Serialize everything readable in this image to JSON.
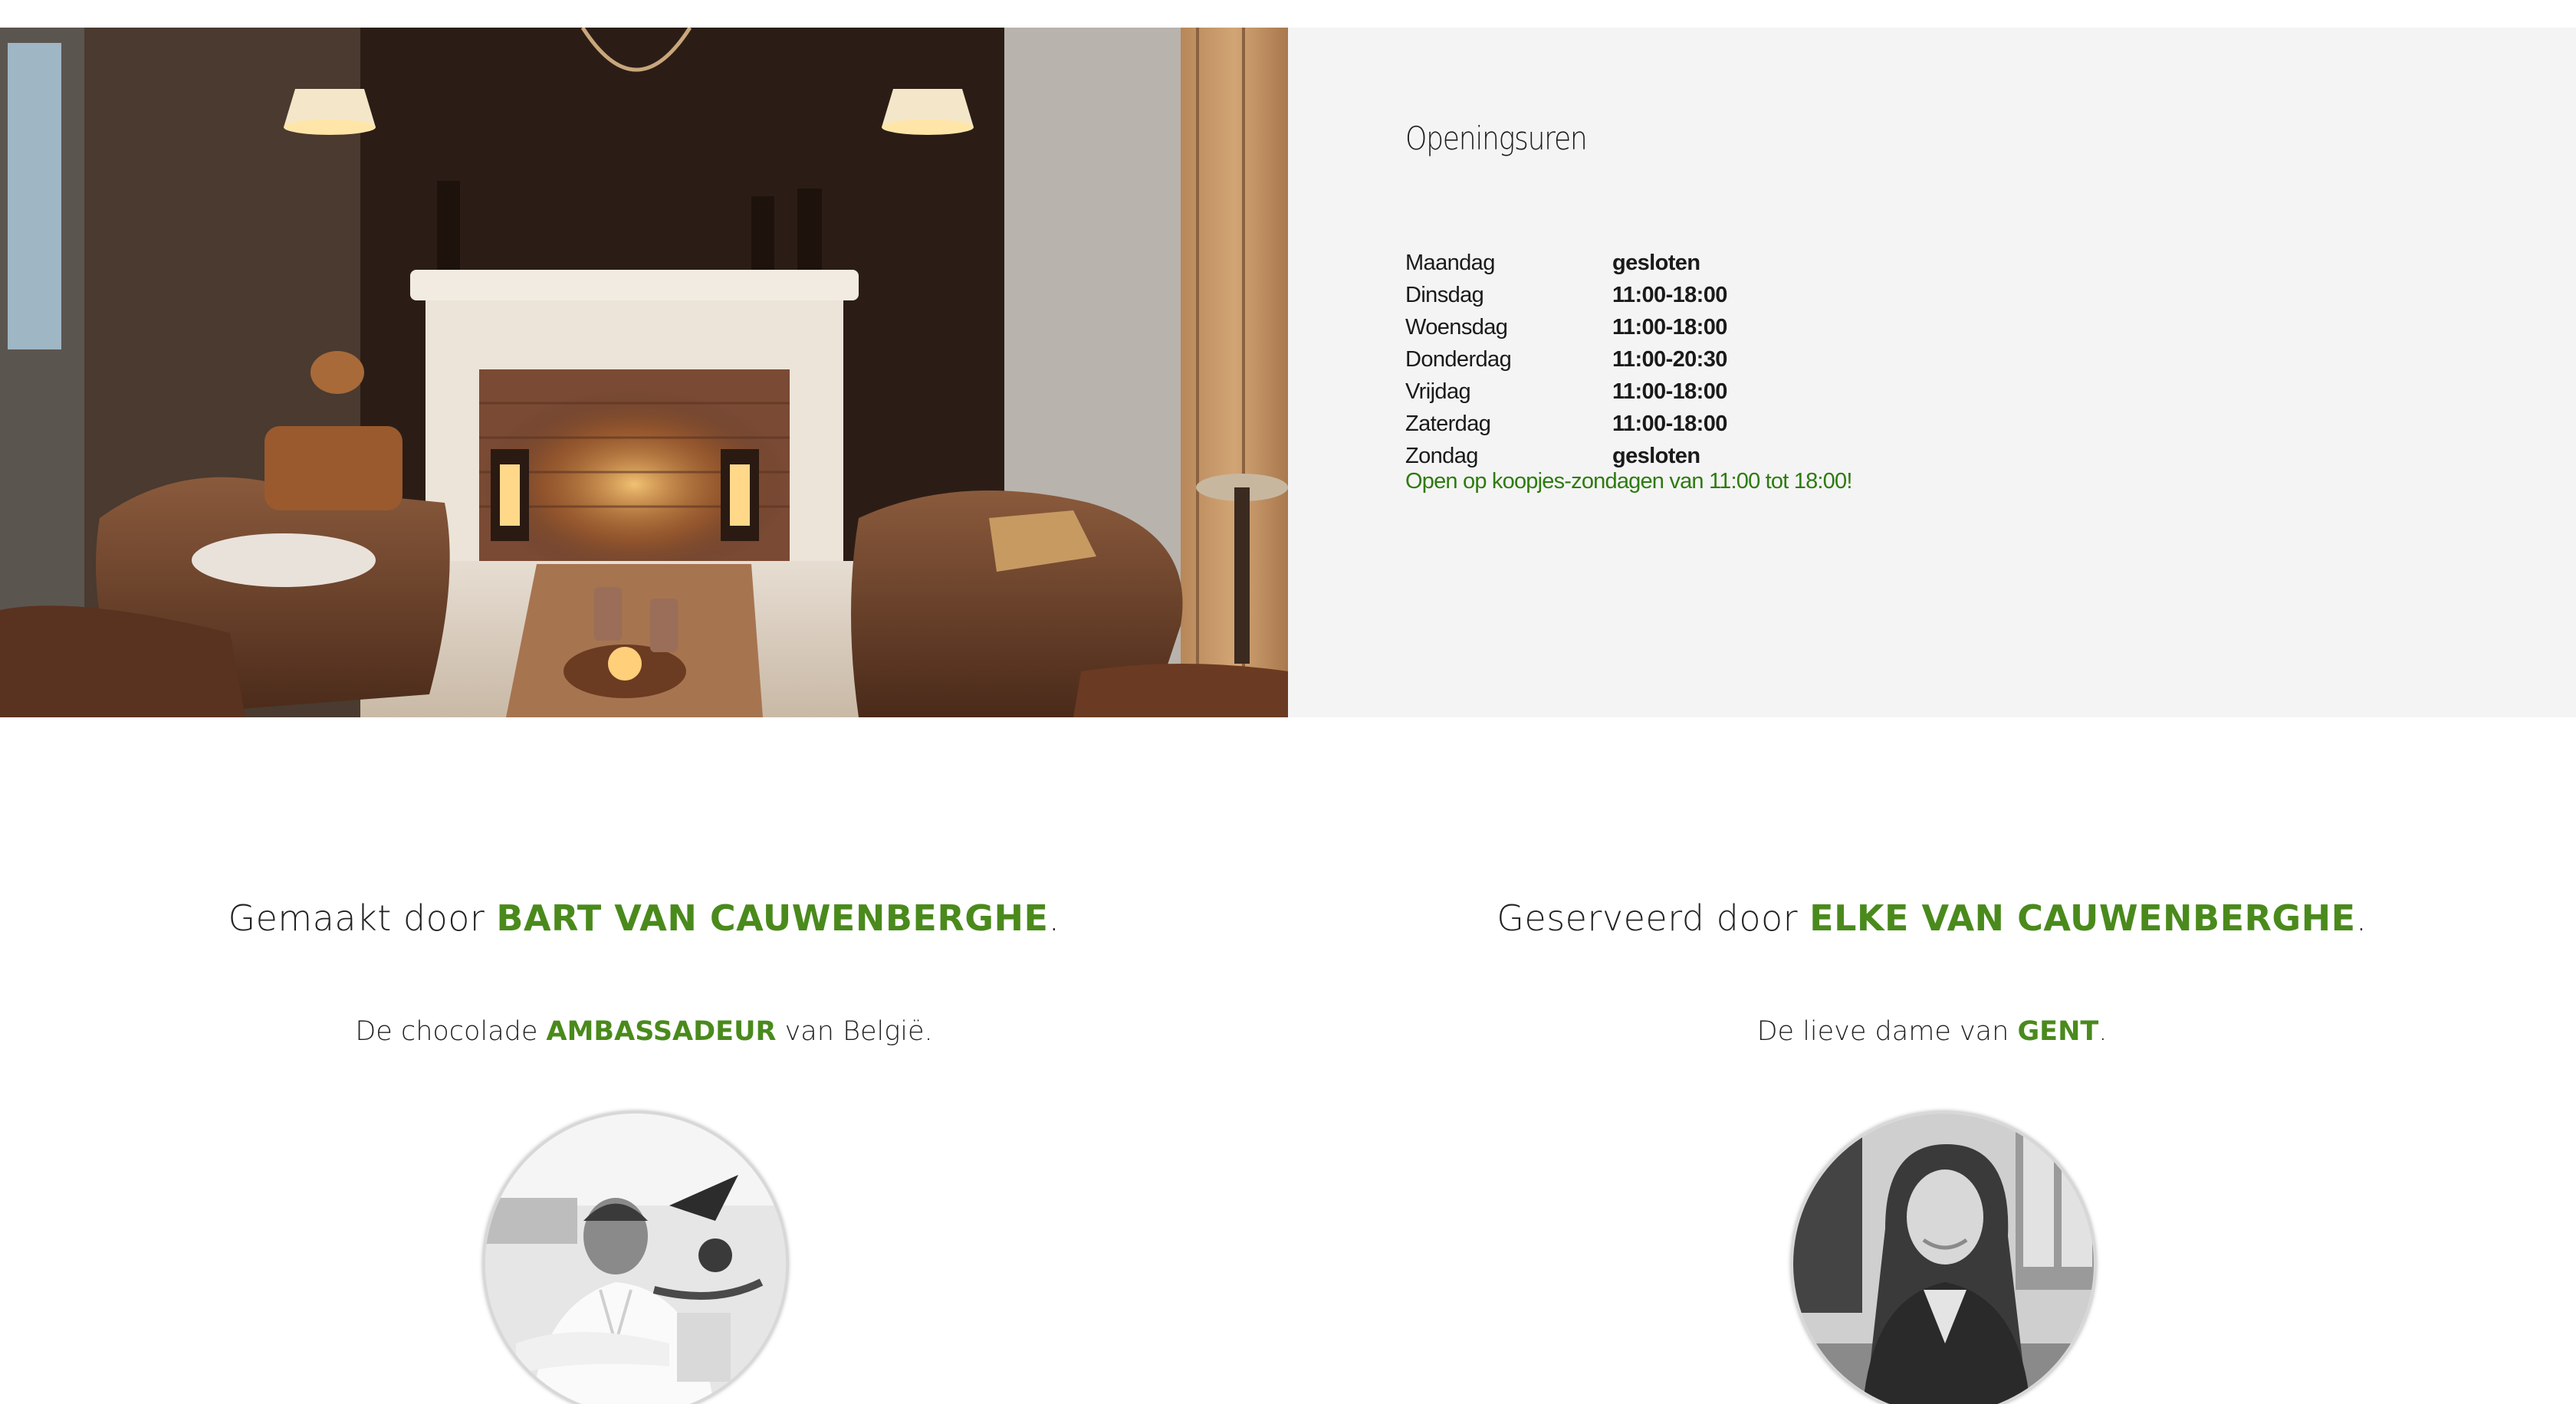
{
  "hours": {
    "title": "Openingsuren",
    "rows": [
      {
        "day": "Maandag",
        "time": "gesloten"
      },
      {
        "day": "Dinsdag",
        "time": "11:00-18:00"
      },
      {
        "day": "Woensdag",
        "time": "11:00-18:00"
      },
      {
        "day": "Donderdag",
        "time": "11:00-20:30"
      },
      {
        "day": "Vrijdag",
        "time": "11:00-18:00"
      },
      {
        "day": "Zaterdag",
        "time": "11:00-18:00"
      },
      {
        "day": "Zondag",
        "time": "gesloten"
      }
    ],
    "note": "Open op koopjes-zondagen van 11:00 tot 18:00!"
  },
  "people": [
    {
      "heading_prefix": "Gemaakt door ",
      "heading_name": "BART VAN CAUWENBERGHE",
      "heading_suffix": ".",
      "sub_prefix": "De chocolade ",
      "sub_accent": "AMBASSADEUR",
      "sub_suffix": " van België."
    },
    {
      "heading_prefix": "Geserveerd door ",
      "heading_name": "ELKE VAN CAUWENBERGHE",
      "heading_suffix": ".",
      "sub_prefix": "De lieve dame van ",
      "sub_accent": "GENT",
      "sub_suffix": "."
    }
  ],
  "colors": {
    "accent_green": "#4a8a1c",
    "note_green": "#2e7a10",
    "panel_bg": "#f4f4f4",
    "text": "#222222"
  }
}
